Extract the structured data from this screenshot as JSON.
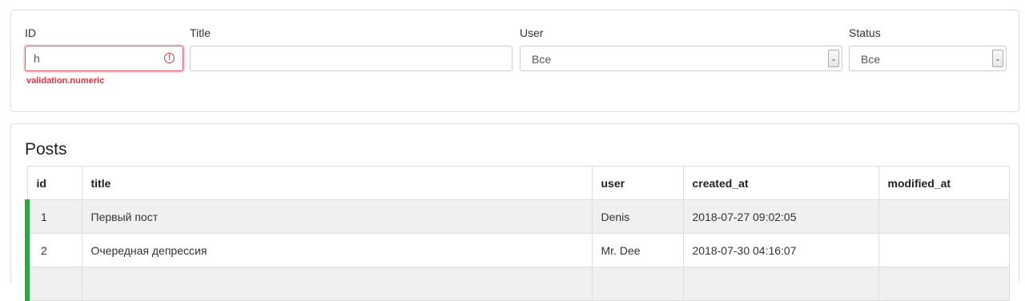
{
  "filters": {
    "id": {
      "label": "ID",
      "value": "h",
      "error": "validation.numeric"
    },
    "title": {
      "label": "Title",
      "value": ""
    },
    "user": {
      "label": "User",
      "selected": "Все"
    },
    "status": {
      "label": "Status",
      "selected": "Все"
    }
  },
  "posts": {
    "heading": "Posts",
    "columns": [
      "id",
      "title",
      "user",
      "created_at",
      "modified_at"
    ],
    "rows": [
      {
        "id": "1",
        "title": "Первый пост",
        "user": "Denis",
        "created_at": "2018-07-27 09:02:05",
        "modified_at": ""
      },
      {
        "id": "2",
        "title": "Очередная депрессия",
        "user": "Mr. Dee",
        "created_at": "2018-07-30 04:16:07",
        "modified_at": ""
      },
      {
        "id": "",
        "title": "",
        "user": "",
        "created_at": "",
        "modified_at": ""
      }
    ]
  },
  "colors": {
    "row_status": "#28a745",
    "error": "#dc3545"
  },
  "icons": {
    "error": "exclamation-circle-icon",
    "select_arrow": "chevron-down-icon"
  }
}
